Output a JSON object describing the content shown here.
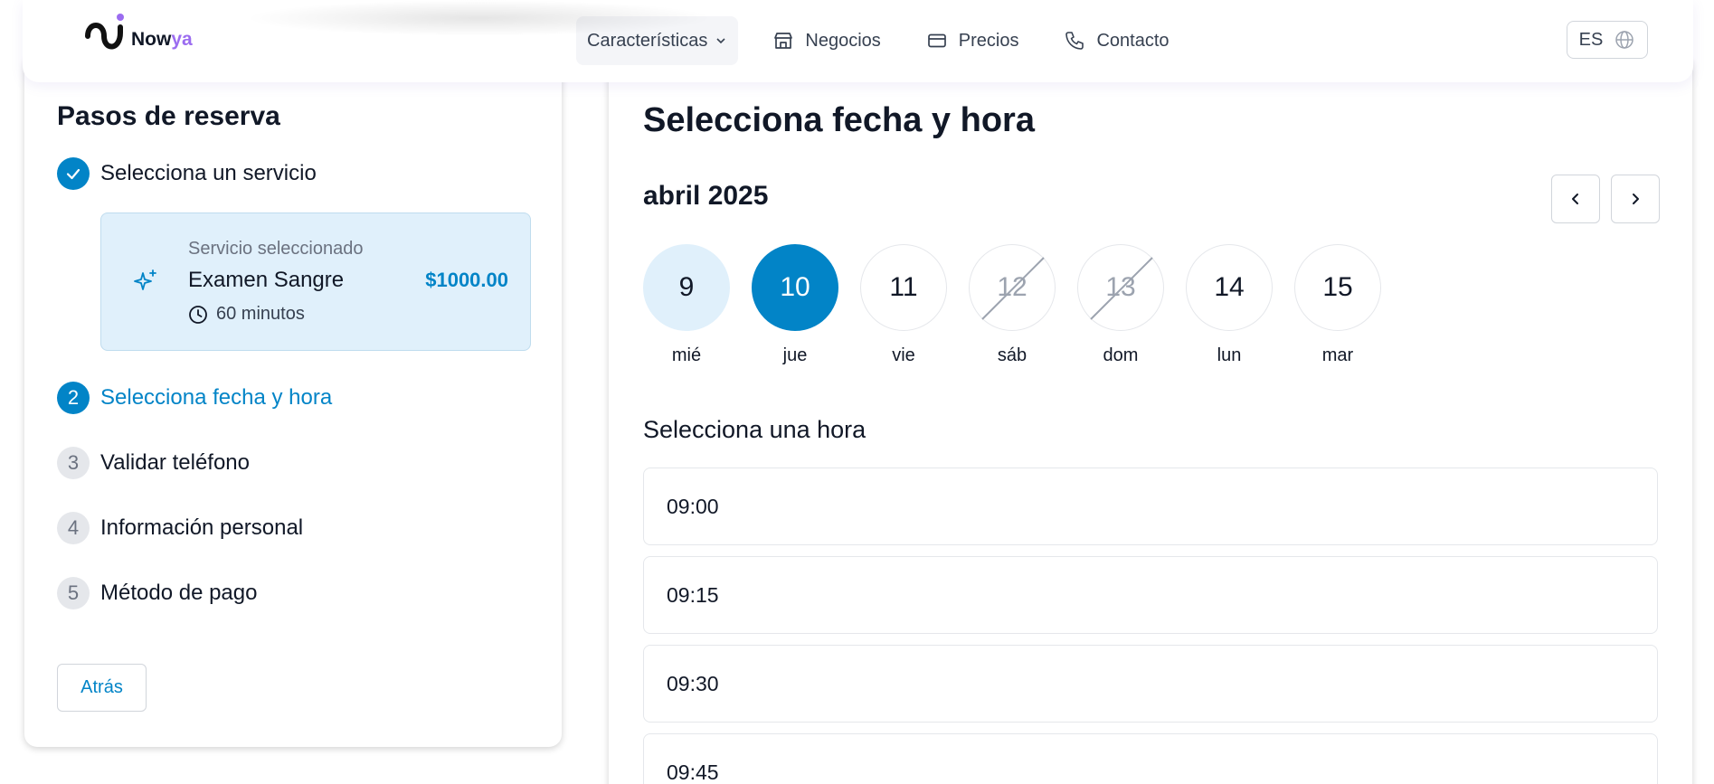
{
  "header": {
    "logo": {
      "text_main": "Now",
      "text_accent": "ya",
      "accent_color": "#9b6cf0"
    },
    "nav": [
      {
        "label": "Características",
        "icon": "chevron-down-icon"
      },
      {
        "label": "Negocios",
        "icon": "store-icon"
      },
      {
        "label": "Precios",
        "icon": "credit-card-icon"
      },
      {
        "label": "Contacto",
        "icon": "phone-icon"
      }
    ],
    "language": {
      "label": "ES",
      "icon": "globe-icon"
    }
  },
  "steps": {
    "title": "Pasos de reserva",
    "items": [
      {
        "number": "",
        "label": "Selecciona un servicio",
        "status": "done"
      },
      {
        "number": "2",
        "label": "Selecciona fecha y hora",
        "status": "active"
      },
      {
        "number": "3",
        "label": "Validar teléfono",
        "status": "pending"
      },
      {
        "number": "4",
        "label": "Información personal",
        "status": "pending"
      },
      {
        "number": "5",
        "label": "Método de pago",
        "status": "pending"
      }
    ],
    "selected_service": {
      "caption": "Servicio seleccionado",
      "name": "Examen Sangre",
      "price": "$1000.00",
      "duration": "60 minutos"
    },
    "back_label": "Atrás"
  },
  "datetime": {
    "title": "Selecciona fecha y hora",
    "month": "abril 2025",
    "days": [
      {
        "num": "9",
        "name": "mié",
        "state": "today"
      },
      {
        "num": "10",
        "name": "jue",
        "state": "selected"
      },
      {
        "num": "11",
        "name": "vie",
        "state": "available"
      },
      {
        "num": "12",
        "name": "sáb",
        "state": "disabled"
      },
      {
        "num": "13",
        "name": "dom",
        "state": "disabled"
      },
      {
        "num": "14",
        "name": "lun",
        "state": "available"
      },
      {
        "num": "15",
        "name": "mar",
        "state": "available"
      }
    ],
    "time_heading": "Selecciona una hora",
    "slots": [
      "09:00",
      "09:15",
      "09:30",
      "09:45"
    ]
  },
  "colors": {
    "primary": "#0284c7",
    "primary_light": "#e0f0fb",
    "accent_purple": "#9b6cf0"
  }
}
